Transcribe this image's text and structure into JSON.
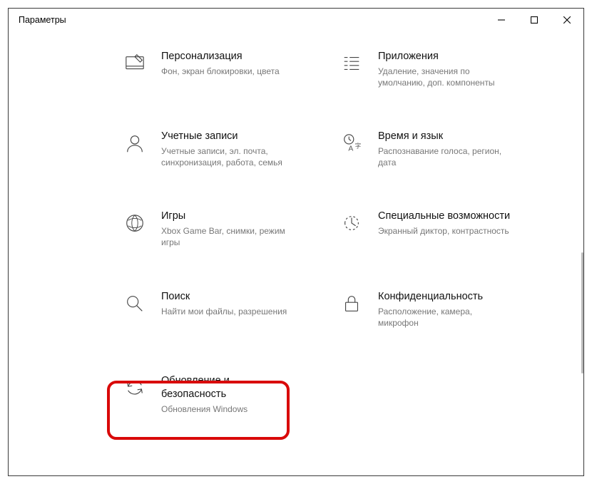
{
  "window": {
    "title": "Параметры"
  },
  "tiles": {
    "personalization": {
      "title": "Персонализация",
      "desc": "Фон, экран блокировки, цвета"
    },
    "apps": {
      "title": "Приложения",
      "desc": "Удаление, значения по умолчанию, доп. компоненты"
    },
    "accounts": {
      "title": "Учетные записи",
      "desc": "Учетные записи, эл. почта, синхронизация, работа, семья"
    },
    "time": {
      "title": "Время и язык",
      "desc": "Распознавание голоса, регион, дата"
    },
    "gaming": {
      "title": "Игры",
      "desc": "Xbox Game Bar, снимки, режим игры"
    },
    "accessibility": {
      "title": "Специальные возможности",
      "desc": "Экранный диктор, контрастность"
    },
    "search": {
      "title": "Поиск",
      "desc": "Найти мои файлы, разрешения"
    },
    "privacy": {
      "title": "Конфиденциальность",
      "desc": "Расположение, камера, микрофон"
    },
    "update": {
      "title": "Обновление и безопасность",
      "desc": "Обновления Windows"
    }
  }
}
